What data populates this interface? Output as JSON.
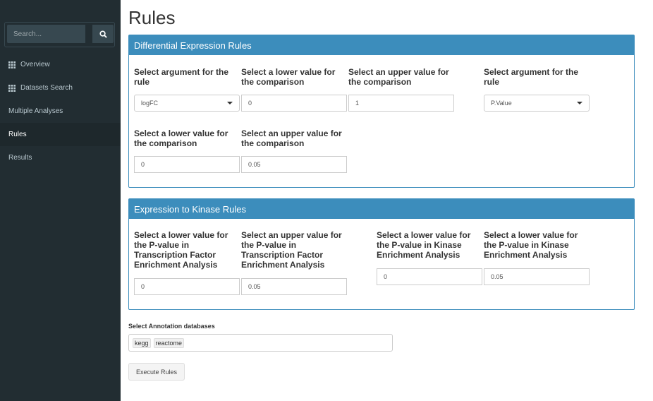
{
  "sidebar": {
    "search": {
      "placeholder": "Search..."
    },
    "items": [
      {
        "label": "Overview",
        "icon": "grid-icon"
      },
      {
        "label": "Datasets Search",
        "icon": "grid-icon"
      },
      {
        "label": "Multiple Analyses",
        "icon": ""
      },
      {
        "label": "Rules",
        "icon": "",
        "active": true
      },
      {
        "label": "Results",
        "icon": ""
      }
    ]
  },
  "page": {
    "title": "Rules"
  },
  "de_rules": {
    "header": "Differential Expression Rules",
    "arg1_label": "Select argument for the rule",
    "arg1_value": "logFC",
    "lower1_label": "Select a lower value for the comparison",
    "lower1_value": "0",
    "upper1_label": "Select an upper value for the comparison",
    "upper1_value": "1",
    "arg2_label": "Select argument for the rule",
    "arg2_value": "P.Value",
    "lower2_label": "Select a lower value for the comparison",
    "lower2_value": "0",
    "upper2_label": "Select an upper value for the comparison",
    "upper2_value": "0.05"
  },
  "kinase_rules": {
    "header": "Expression to Kinase Rules",
    "tf_lower_label": "Select a lower value for the P-value in Transcription Factor Enrichment Analysis",
    "tf_lower_value": "0",
    "tf_upper_label": "Select an upper value for the P-value in Transcription Factor Enrichment Analysis",
    "tf_upper_value": "0.05",
    "kea_lower_label": "Select a lower value for the P-value in Kinase Enrichment Analysis",
    "kea_lower_value": "0",
    "kea_lower2_label": "Select a lower value for the P-value in Kinase Enrichment Analysis",
    "kea_lower2_value": "0.05"
  },
  "annotation": {
    "label": "Select Annotation databases",
    "tags": [
      "kegg",
      "reactome"
    ]
  },
  "execute_label": "Execute Rules",
  "colors": {
    "sidebar": "#222d32",
    "accent": "#3c8dbc"
  }
}
